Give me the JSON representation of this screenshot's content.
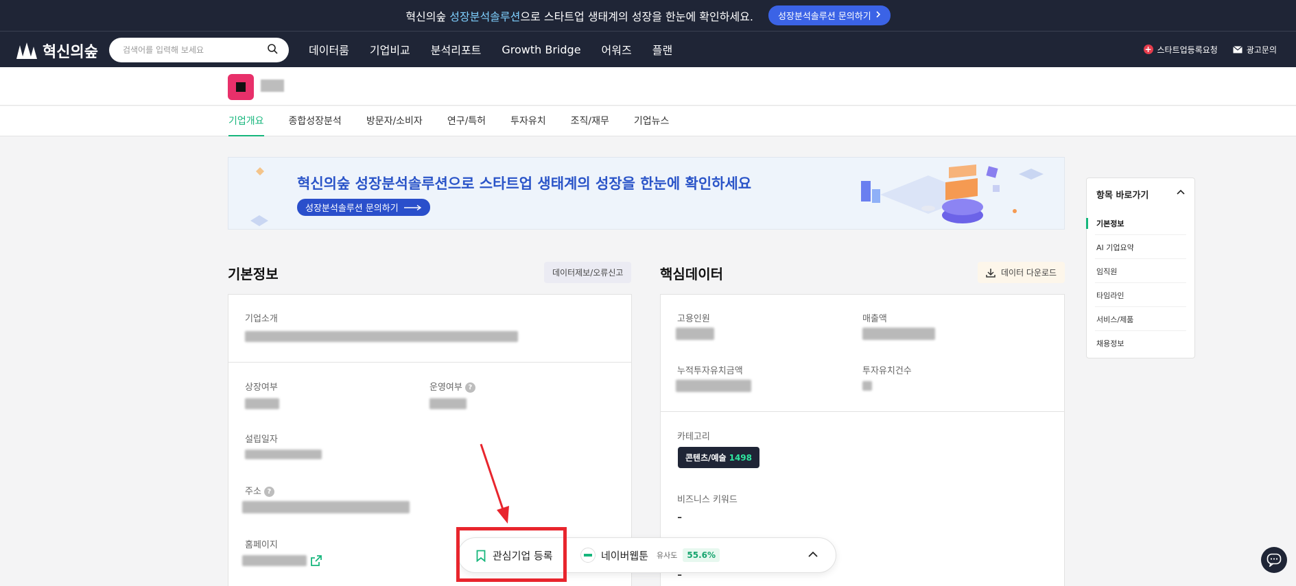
{
  "announce": {
    "text_before": "혁신의숲 ",
    "text_highlight": "성장분석솔루션",
    "text_after": "으로 스타트업 생태계의 성장을 한눈에 확인하세요.",
    "button_label": "성장분석솔루션 문의하기"
  },
  "nav": {
    "logo_text": "혁신의숲",
    "search_placeholder": "검색어를 입력해 보세요",
    "menu": [
      "데이터룸",
      "기업비교",
      "분석리포트",
      "Growth Bridge",
      "어워즈",
      "플랜"
    ],
    "register_label": "스타트업등록요청",
    "ad_label": "광고문의"
  },
  "tabs": [
    "기업개요",
    "종합성장분석",
    "방문자/소비자",
    "연구/특허",
    "투자유치",
    "조직/재무",
    "기업뉴스"
  ],
  "banner": {
    "title": "혁신의숲 성장분석솔루션으로 스타트업 생태계의 성장을 한눈에 확인하세요",
    "button_label": "성장분석솔루션 문의하기"
  },
  "basic_info": {
    "title": "기본정보",
    "report_button": "데이터제보/오류신고",
    "intro_label": "기업소개",
    "listing_label": "상장여부",
    "operation_label": "운영여부",
    "founded_label": "설립일자",
    "address_label": "주소",
    "homepage_label": "홈페이지"
  },
  "core_data": {
    "title": "핵심데이터",
    "download_button": "데이터 다운로드",
    "employees_label": "고용인원",
    "revenue_label": "매출액",
    "cum_investment_label": "누적투자유치금액",
    "investment_count_label": "투자유치건수",
    "category_label": "카테고리",
    "category_tag": "콘텐츠/예술",
    "category_count": "1498",
    "keyword_label": "비즈니스 키워드",
    "keyword_value": "-",
    "extra_value": "-"
  },
  "toc": {
    "title": "항목 바로가기",
    "items": [
      "기본정보",
      "AI 기업요약",
      "임직원",
      "타임라인",
      "서비스/제품",
      "채용정보"
    ]
  },
  "float_bar": {
    "fav_label": "관심기업 등록",
    "compare_company": "네이버웹툰",
    "similarity_label": "유사도",
    "similarity_value": "55.6%"
  },
  "colors": {
    "brand_dark": "#1f2536",
    "accent_green": "#16b67c",
    "banner_blue": "#2a54c8",
    "highlight_red": "#e8252d"
  }
}
